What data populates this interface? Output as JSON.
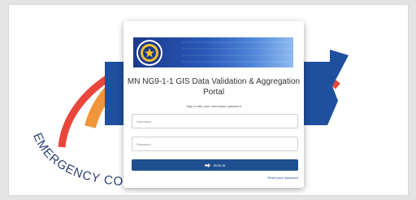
{
  "page": {
    "title": "MN NG9-1-1 GIS Data Validation & Aggregation Portal",
    "subtitle": "Sign in with your username/ password",
    "background_text": "EMERGENCY COMMUNICATIONS"
  },
  "form": {
    "username_placeholder": "Username",
    "password_placeholder": "Password",
    "signin_label": "SIGN IN",
    "signin_icon": "sign-in-arrow-icon",
    "reset_label": "Reset your password"
  },
  "colors": {
    "primary": "#1f4f8f",
    "arc_red": "#e8473a",
    "arc_orange": "#f0953a",
    "state_blue": "#1f4f9f",
    "text_navy": "#2a3f7a"
  }
}
